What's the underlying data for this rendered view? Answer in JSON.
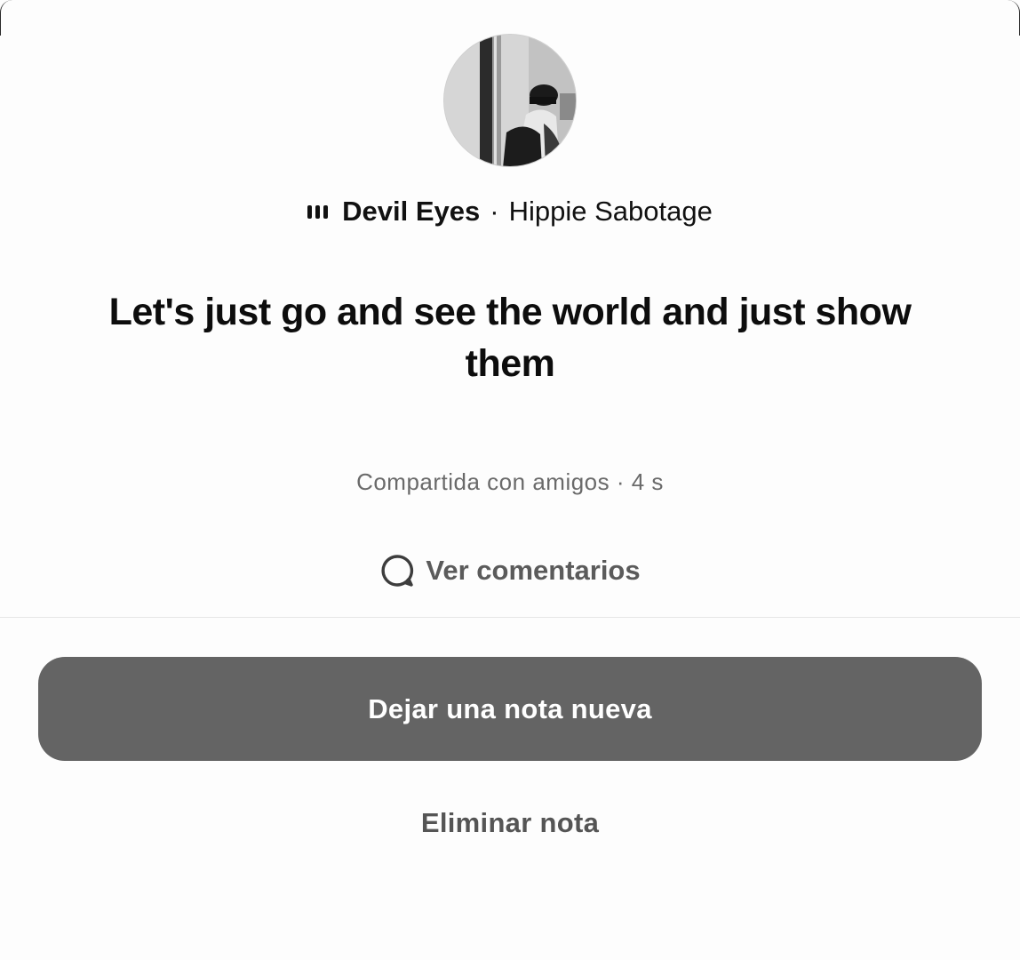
{
  "note": {
    "avatar_alt": "profile-photo",
    "song_title": "Devil Eyes",
    "separator": "·",
    "artist": "Hippie Sabotage",
    "text": "Let's just go and see the world and just show them",
    "meta": "Compartida con amigos · 4 s"
  },
  "actions": {
    "comments_label": "Ver comentarios",
    "new_note_label": "Dejar una nota nueva",
    "delete_label": "Eliminar nota"
  },
  "colors": {
    "primary_button": "#646464",
    "text_primary": "#0d0d0d",
    "text_secondary": "#6a6a6a",
    "background": "#fdfdfd"
  },
  "icons": {
    "music": "audio-bars-icon",
    "comments": "speech-bubble-icon"
  }
}
